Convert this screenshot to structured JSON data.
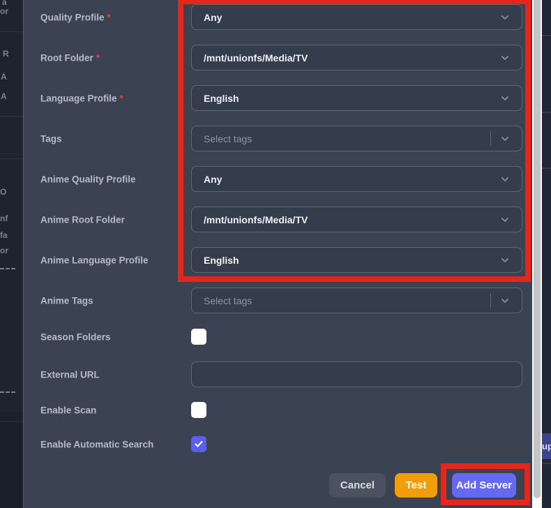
{
  "modal": {
    "required_marker": "*",
    "fields": [
      {
        "label": "Quality Profile",
        "required": true,
        "type": "select",
        "value": "Any"
      },
      {
        "label": "Root Folder",
        "required": true,
        "type": "select",
        "value": "/mnt/unionfs/Media/TV"
      },
      {
        "label": "Language Profile",
        "required": true,
        "type": "select",
        "value": "English"
      },
      {
        "label": "Tags",
        "required": false,
        "type": "multiselect",
        "placeholder": "Select tags"
      },
      {
        "label": "Anime Quality Profile",
        "required": false,
        "type": "select",
        "value": "Any"
      },
      {
        "label": "Anime Root Folder",
        "required": false,
        "type": "select",
        "value": "/mnt/unionfs/Media/TV"
      },
      {
        "label": "Anime Language Profile",
        "required": false,
        "type": "select",
        "value": "English"
      },
      {
        "label": "Anime Tags",
        "required": false,
        "type": "multiselect",
        "placeholder": "Select tags"
      },
      {
        "label": "Season Folders",
        "required": false,
        "type": "checkbox",
        "checked": false
      },
      {
        "label": "External URL",
        "required": false,
        "type": "text",
        "value": ""
      },
      {
        "label": "Enable Scan",
        "required": false,
        "type": "checkbox",
        "checked": false
      },
      {
        "label": "Enable Automatic Search",
        "required": false,
        "type": "checkbox",
        "checked": true
      }
    ],
    "buttons": {
      "cancel": "Cancel",
      "test": "Test",
      "add_server": "Add Server"
    }
  },
  "background_page": {
    "left_fragments": [
      "a",
      "or",
      "R",
      "A",
      "A",
      "O",
      "nf",
      "fa",
      "or"
    ],
    "right_fragment": "up"
  },
  "colors": {
    "annotation_red": "#e8251a",
    "test_button_orange": "#f09e0c",
    "add_server_indigo": "#6568f1",
    "checkbox_checked_indigo": "#5b5fee"
  }
}
